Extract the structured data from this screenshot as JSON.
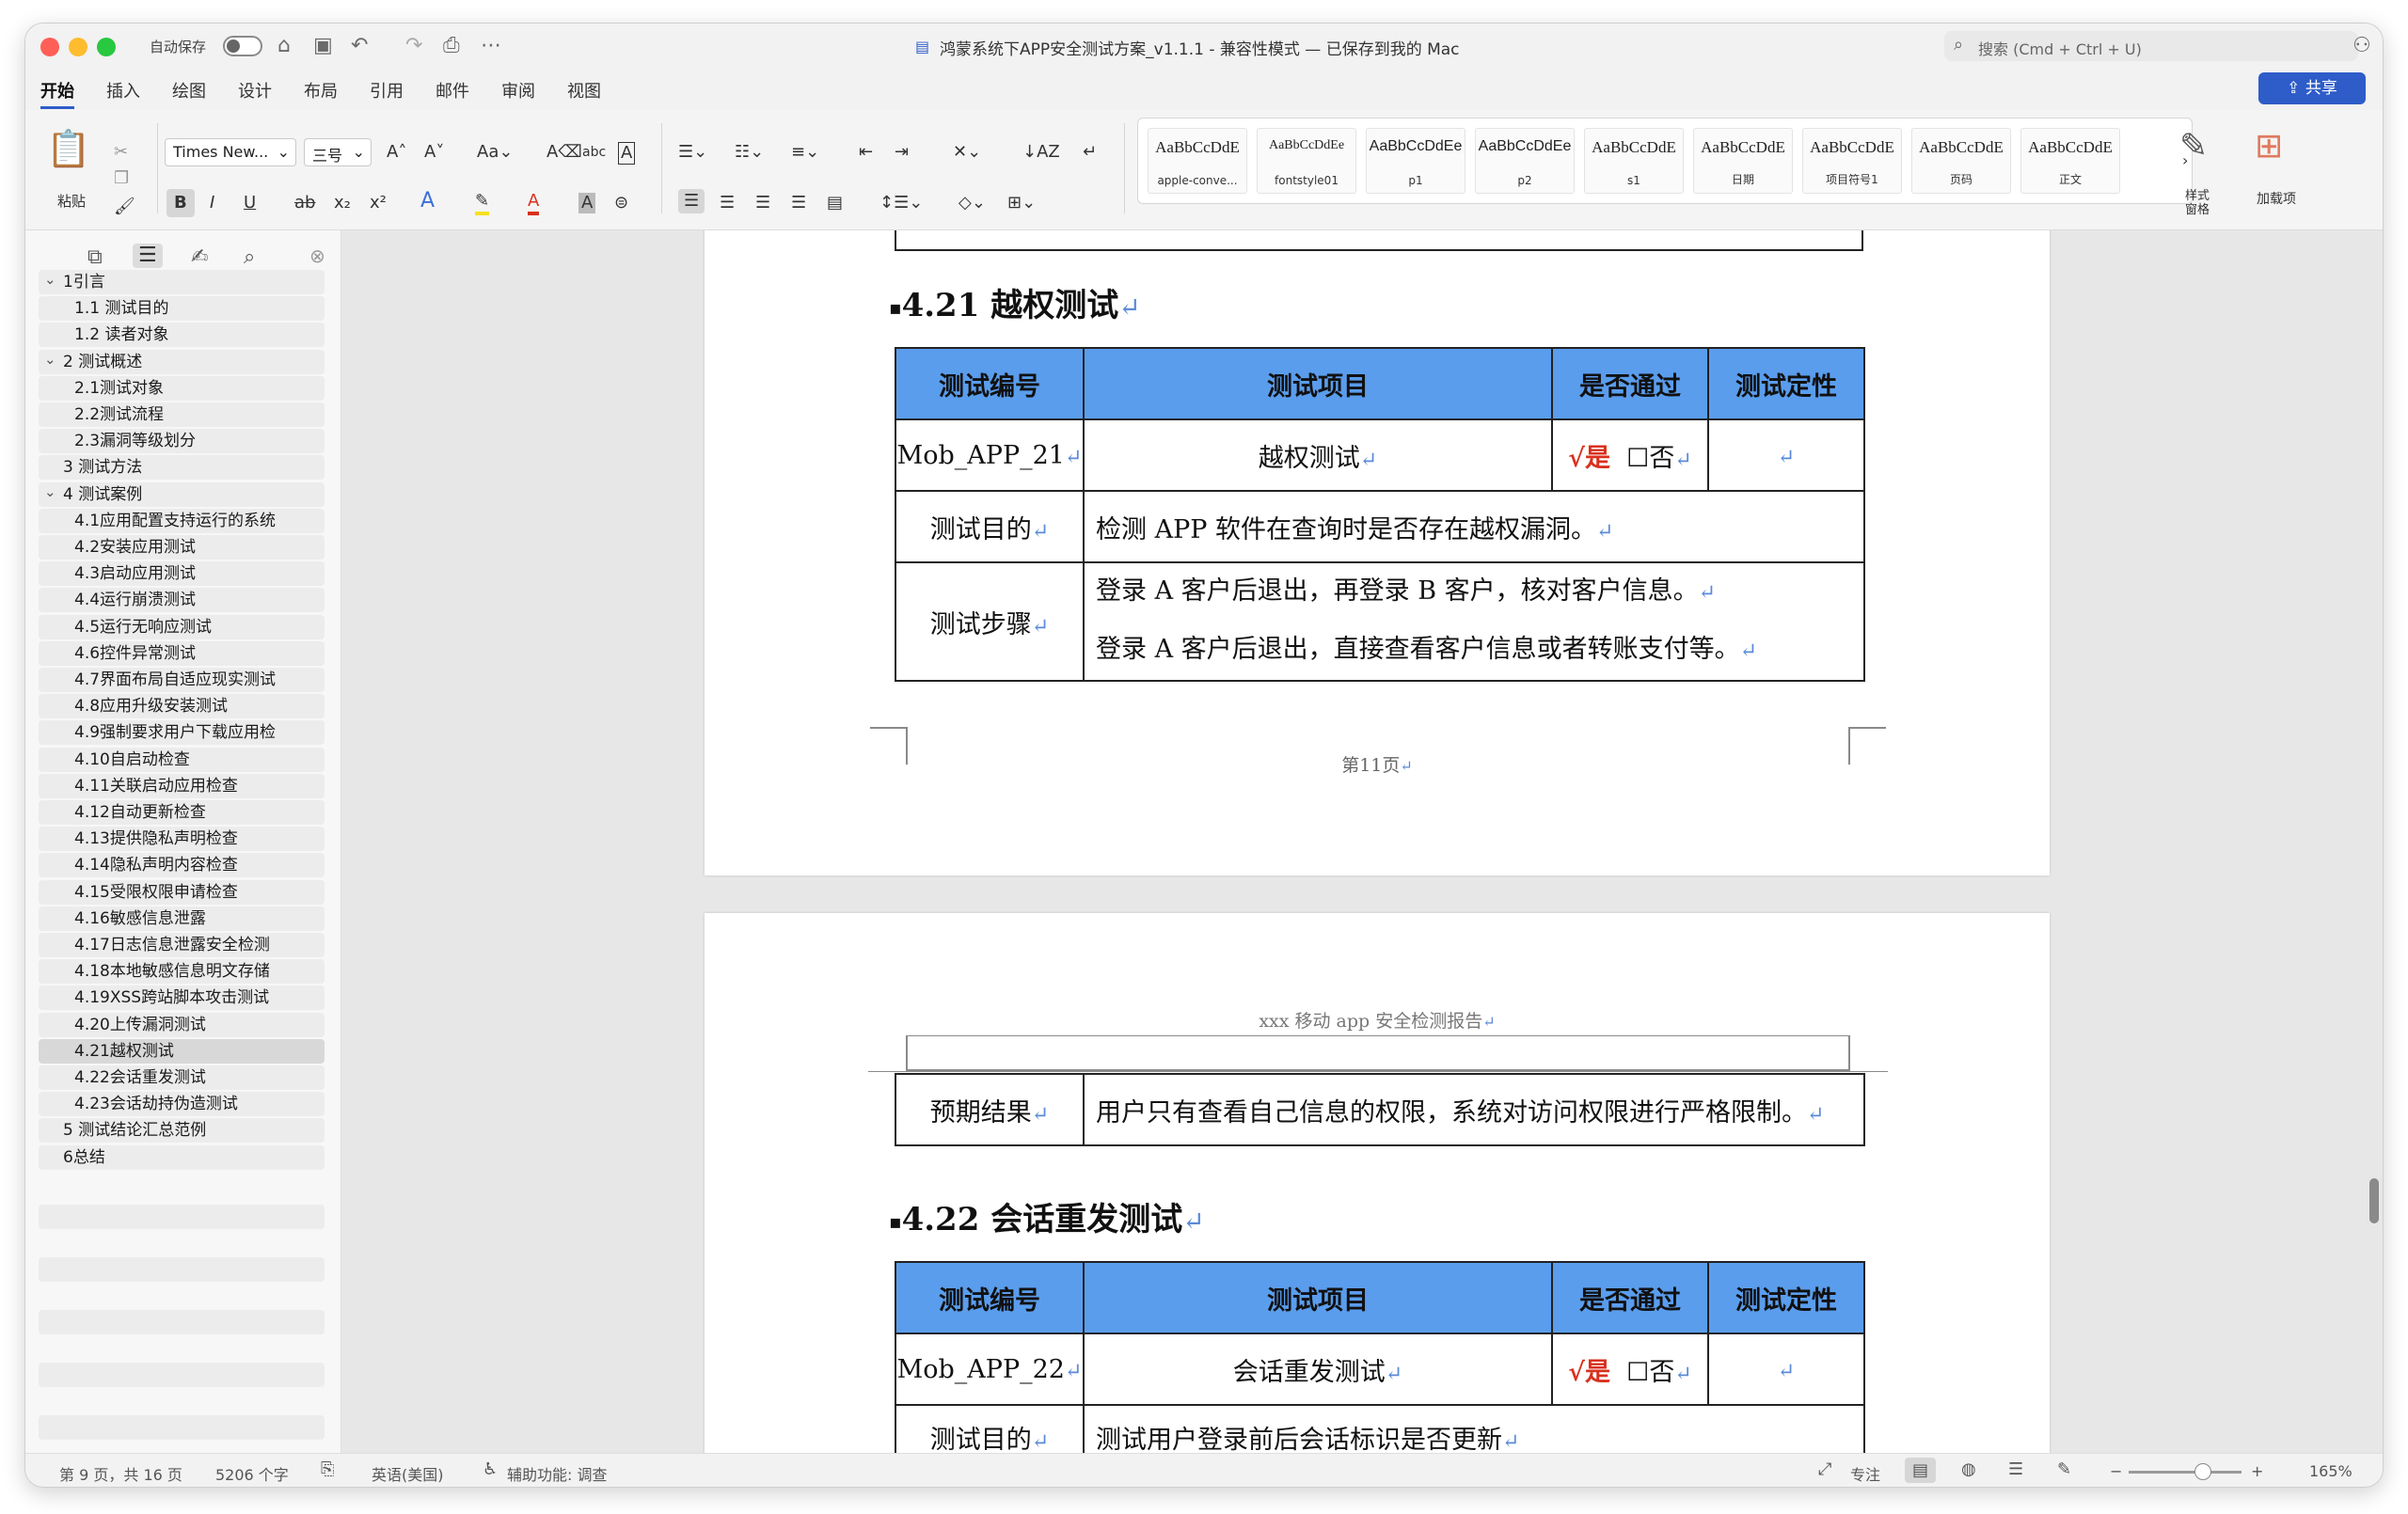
{
  "titlebar": {
    "autosave_label": "自动保存",
    "document_title": "鸿蒙系统下APP安全测试方案_v1.1.1 - 兼容性模式 — 已保存到我的 Mac",
    "search_placeholder": "搜索 (Cmd + Ctrl + U)"
  },
  "tabs": [
    "开始",
    "插入",
    "绘图",
    "设计",
    "布局",
    "引用",
    "邮件",
    "审阅",
    "视图"
  ],
  "share_label": "共享",
  "ribbon": {
    "paste_label": "粘贴",
    "font_name": "Times New...",
    "font_size": "三号",
    "style_pane_label": "样式\n窗格",
    "addins_label": "加载项",
    "styles": [
      {
        "preview": "AaBbCcDdE",
        "name": "apple-conve..."
      },
      {
        "preview": "AaBbCcDdEe",
        "name": "fontstyle01"
      },
      {
        "preview": "AaBbCcDdEe",
        "name": "p1"
      },
      {
        "preview": "AaBbCcDdEe",
        "name": "p2"
      },
      {
        "preview": "AaBbCcDdE",
        "name": "s1"
      },
      {
        "preview": "AaBbCcDdE",
        "name": "日期"
      },
      {
        "preview": "AaBbCcDdE",
        "name": "项目符号1"
      },
      {
        "preview": "AaBbCcDdE",
        "name": "页码"
      },
      {
        "preview": "AaBbCcDdE",
        "name": "正文"
      }
    ]
  },
  "nav_items": [
    {
      "label": "1引言",
      "level": 1,
      "collapsible": true
    },
    {
      "label": "1.1 测试目的",
      "level": 2
    },
    {
      "label": "1.2 读者对象",
      "level": 2
    },
    {
      "label": "2 测试概述",
      "level": 1,
      "collapsible": true
    },
    {
      "label": "2.1测试对象",
      "level": 2
    },
    {
      "label": "2.2测试流程",
      "level": 2
    },
    {
      "label": "2.3漏洞等级划分",
      "level": 2
    },
    {
      "label": "3 测试方法",
      "level": 1
    },
    {
      "label": "4 测试案例",
      "level": 1,
      "collapsible": true
    },
    {
      "label": "4.1应用配置支持运行的系统",
      "level": 2
    },
    {
      "label": "4.2安装应用测试",
      "level": 2
    },
    {
      "label": "4.3启动应用测试",
      "level": 2
    },
    {
      "label": "4.4运行崩溃测试",
      "level": 2
    },
    {
      "label": "4.5运行无响应测试",
      "level": 2
    },
    {
      "label": "4.6控件异常测试",
      "level": 2
    },
    {
      "label": "4.7界面布局自适应现实测试",
      "level": 2
    },
    {
      "label": "4.8应用升级安装测试",
      "level": 2
    },
    {
      "label": "4.9强制要求用户下载应用检",
      "level": 2
    },
    {
      "label": "4.10自启动检查",
      "level": 2
    },
    {
      "label": "4.11关联启动应用检查",
      "level": 2
    },
    {
      "label": "4.12自动更新检查",
      "level": 2
    },
    {
      "label": "4.13提供隐私声明检查",
      "level": 2
    },
    {
      "label": "4.14隐私声明内容检查",
      "level": 2
    },
    {
      "label": "4.15受限权限申请检查",
      "level": 2
    },
    {
      "label": "4.16敏感信息泄露",
      "level": 2
    },
    {
      "label": "4.17日志信息泄露安全检测",
      "level": 2
    },
    {
      "label": "4.18本地敏感信息明文存储",
      "level": 2
    },
    {
      "label": "4.19XSS跨站脚本攻击测试",
      "level": 2
    },
    {
      "label": "4.20上传漏洞测试",
      "level": 2
    },
    {
      "label": "4.21越权测试",
      "level": 2,
      "selected": true
    },
    {
      "label": "4.22会话重发测试",
      "level": 2
    },
    {
      "label": "4.23会话劫持伪造测试",
      "level": 2
    },
    {
      "label": "5 测试结论汇总范例",
      "level": 1
    },
    {
      "label": "6总结",
      "level": 1
    }
  ],
  "document": {
    "section_421": {
      "heading": "4.21 越权测试",
      "headers": [
        "测试编号",
        "测试项目",
        "是否通过",
        "测试定性"
      ],
      "test_id": "Mob_APP_21",
      "test_item": "越权测试",
      "pass_yes": "√是",
      "pass_no": "☐否",
      "purpose_label": "测试目的",
      "purpose_text": "检测 APP 软件在查询时是否存在越权漏洞。",
      "steps_label": "测试步骤",
      "step1": "登录 A 客户后退出，再登录 B 客户，核对客户信息。",
      "step2": "登录 A 客户后退出，直接查看客户信息或者转账支付等。",
      "expected_label": "预期结果",
      "expected_text": "用户只有查看自己信息的权限，系统对访问权限进行严格限制。"
    },
    "page_footer": "第11页",
    "page_header": "xxx 移动 app 安全检测报告",
    "section_422": {
      "heading": "4.22 会话重发测试",
      "headers": [
        "测试编号",
        "测试项目",
        "是否通过",
        "测试定性"
      ],
      "test_id": "Mob_APP_22",
      "test_item": "会话重发测试",
      "pass_yes": "√是",
      "pass_no": "☐否",
      "purpose_partial": "测试目的",
      "purpose_text_partial": "测试用户登录前后会话标识是否更新"
    }
  },
  "statusbar": {
    "page_info": "第 9 页，共 16 页",
    "word_count": "5206 个字",
    "language": "英语(美国)",
    "accessibility": "辅助功能: 调查",
    "focus_label": "专注",
    "zoom_level": "165%"
  },
  "colors": {
    "table_header": "#5a9ded",
    "accent": "#2e5cc8",
    "check": "#d9301e"
  }
}
